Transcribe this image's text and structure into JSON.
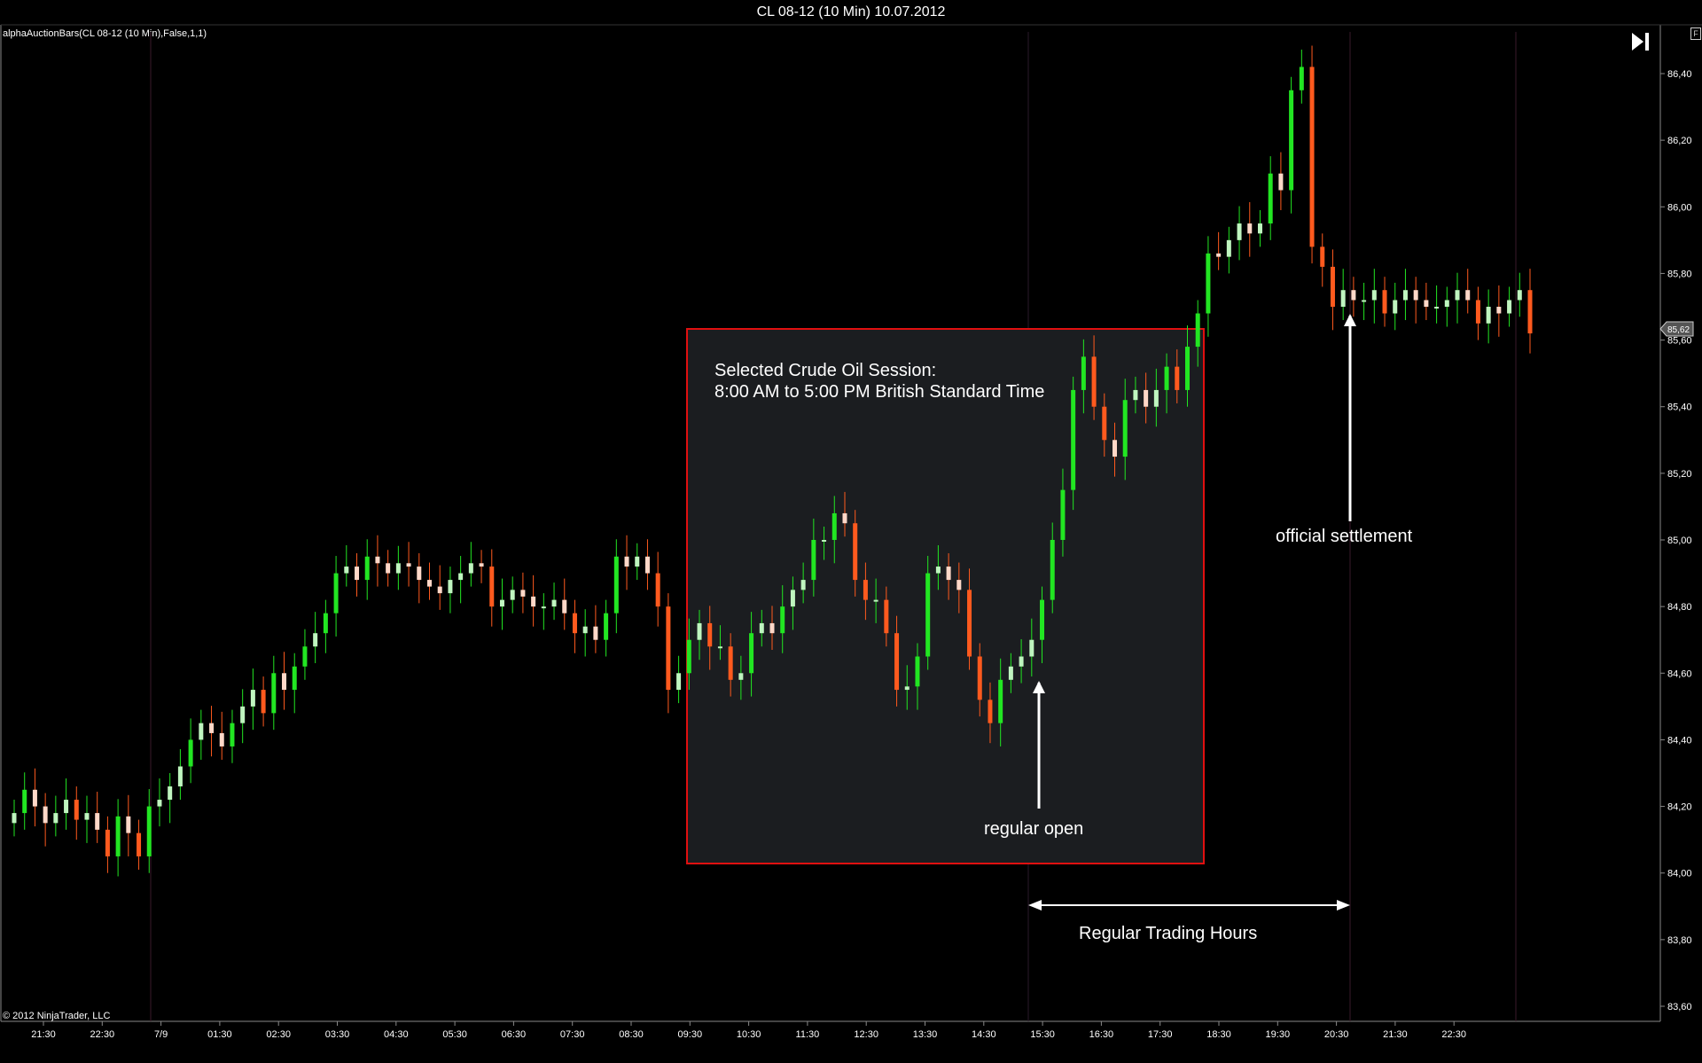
{
  "window": {
    "title": "CL 08-12 (10 Min)  10.07.2012",
    "indicator_label": "alphaAuctionBars(CL 08-12 (10 Min),False,1,1)",
    "copyright": "© 2012 NinjaTrader, LLC",
    "corner_button": "F"
  },
  "colors": {
    "background": "#000000",
    "up_strong": "#22e622",
    "up_light": "#bff5bf",
    "down_strong": "#ff5a1e",
    "down_light": "#ffd8c8",
    "session_box_fill": "#1b1d20",
    "session_box_border": "#e01010",
    "annotation": "#ffffff",
    "price_marker": "#cccccc"
  },
  "annotations": {
    "session_box_line1": "Selected Crude Oil Session:",
    "session_box_line2": "8:00 AM to 5:00 PM British Standard Time",
    "regular_open": "regular open",
    "official_settlement": "official settlement",
    "regular_trading_hours": "Regular Trading Hours"
  },
  "chart_data": {
    "type": "candlestick",
    "title": "CL 08-12 (10 Min)  10.07.2012",
    "xlabel": "",
    "ylabel": "",
    "ylim": [
      83.5,
      86.5
    ],
    "y_ticks": [
      "83,60",
      "83,80",
      "84,00",
      "84,20",
      "84,40",
      "84,60",
      "84,80",
      "85,00",
      "85,20",
      "85,40",
      "85,60",
      "85,80",
      "86,00",
      "86,20",
      "86,40"
    ],
    "x_ticks": [
      "21:30",
      "22:30",
      "7/9",
      "01:30",
      "02:30",
      "03:30",
      "04:30",
      "05:30",
      "06:30",
      "07:30",
      "08:30",
      "09:30",
      "10:30",
      "11:30",
      "12:30",
      "13:30",
      "14:30",
      "15:30",
      "16:30",
      "17:30",
      "18:30",
      "19:30",
      "20:30",
      "21:30",
      "22:30"
    ],
    "last_price": "85,62",
    "grid": false,
    "closes": [
      84.18,
      84.25,
      84.2,
      84.15,
      84.18,
      84.22,
      84.16,
      84.18,
      84.13,
      84.05,
      84.17,
      84.12,
      84.05,
      84.2,
      84.22,
      84.26,
      84.32,
      84.4,
      84.45,
      84.42,
      84.38,
      84.45,
      84.5,
      84.55,
      84.48,
      84.6,
      84.55,
      84.62,
      84.68,
      84.72,
      84.78,
      84.9,
      84.92,
      84.88,
      84.95,
      84.93,
      84.9,
      84.93,
      84.92,
      84.88,
      84.86,
      84.84,
      84.88,
      84.9,
      84.93,
      84.92,
      84.8,
      84.82,
      84.85,
      84.83,
      84.8,
      84.8,
      84.82,
      84.78,
      84.72,
      84.74,
      84.7,
      84.78,
      84.95,
      84.92,
      84.95,
      84.9,
      84.8,
      84.55,
      84.6,
      84.7,
      84.75,
      84.68,
      84.68,
      84.58,
      84.6,
      84.72,
      84.75,
      84.72,
      84.8,
      84.85,
      84.88,
      85.0,
      85.0,
      85.08,
      85.05,
      84.88,
      84.82,
      84.82,
      84.72,
      84.55,
      84.56,
      84.65,
      84.9,
      84.92,
      84.88,
      84.85,
      84.65,
      84.52,
      84.45,
      84.58,
      84.62,
      84.65,
      84.7,
      84.82,
      85.0,
      85.15,
      85.45,
      85.55,
      85.4,
      85.3,
      85.25,
      85.42,
      85.45,
      85.4,
      85.45,
      85.52,
      85.45,
      85.58,
      85.68,
      85.86,
      85.85,
      85.9,
      85.95,
      85.92,
      85.95,
      86.1,
      86.05,
      86.35,
      86.42,
      85.88,
      85.82,
      85.7,
      85.75,
      85.72,
      85.72,
      85.75,
      85.68,
      85.72,
      85.75,
      85.72,
      85.7,
      85.7,
      85.72,
      85.75,
      85.72,
      85.65,
      85.7,
      85.68,
      85.72,
      85.75,
      85.62
    ]
  }
}
